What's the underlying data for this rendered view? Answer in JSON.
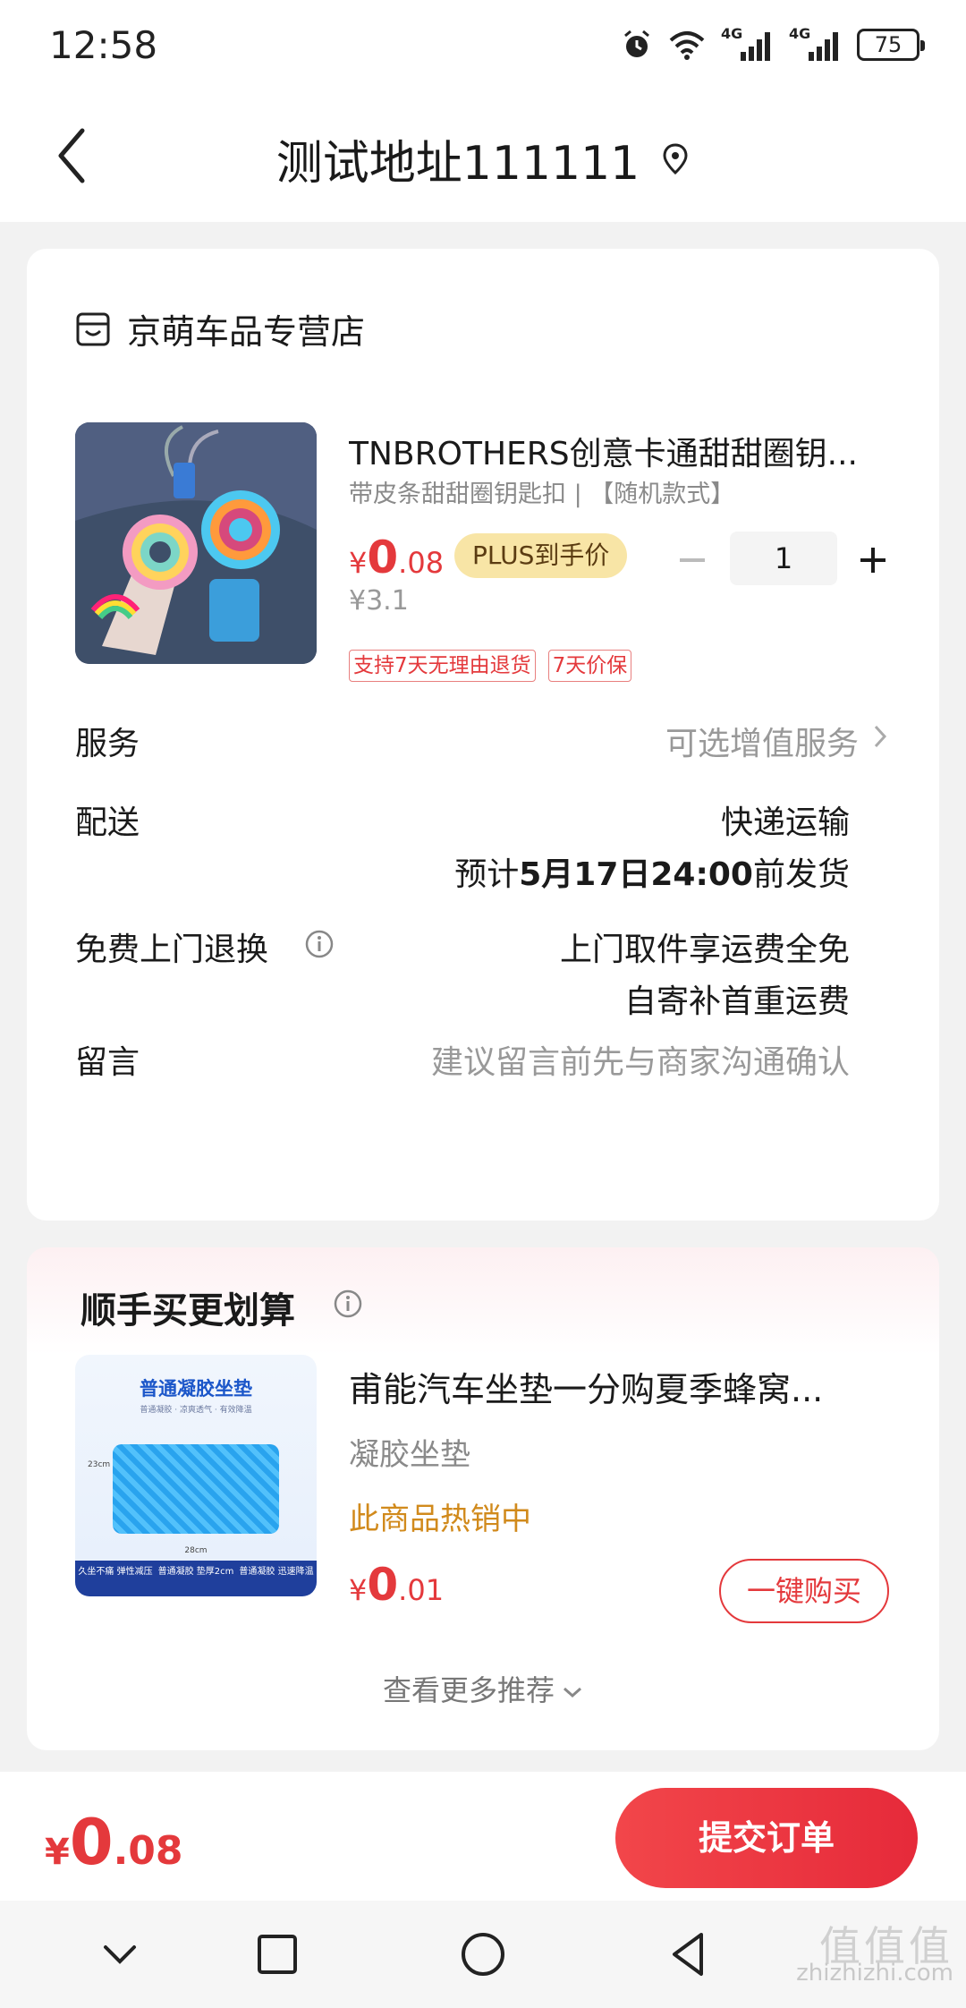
{
  "status_bar": {
    "time": "12:58",
    "signal1_label": "4G",
    "signal2_label": "4G",
    "battery": "75"
  },
  "header": {
    "title": "测试地址111111"
  },
  "store": {
    "name": "京萌车品专营店"
  },
  "product": {
    "title": "TNBROTHERS创意卡通甜甜圈钥...",
    "spec": "带皮条甜甜圈钥匙扣 | 【随机款式】",
    "price_symbol": "¥",
    "price_int": "0",
    "price_dec": ".08",
    "plus_tag": "PLUS到手价",
    "original_price": "¥3.1",
    "quantity": "1",
    "tags": [
      "支持7天无理由退货",
      "7天价保"
    ]
  },
  "rows": {
    "service_label": "服务",
    "service_value": "可选增值服务",
    "delivery_label": "配送",
    "delivery_method": "快递运输",
    "delivery_eta_prefix": "预计",
    "delivery_eta": "5月17日24:00",
    "delivery_eta_suffix": "前发货",
    "return_label": "免费上门退换",
    "return_line1": "上门取件享运费全免",
    "return_line2": "自寄补首重运费",
    "message_label": "留言",
    "message_placeholder": "建议留言前先与商家沟通确认"
  },
  "recommend": {
    "section_title": "顺手买更划算",
    "image_title": "普通凝胶坐垫",
    "image_subtitle": "普通凝胶 · 凉爽透气 · 有效降温",
    "image_dim_h": "23cm",
    "image_dim_w": "28cm",
    "image_footer": [
      "久坐不痛 弹性减压",
      "普通凝胶 垫厚2cm",
      "普通凝胶 迅速降温"
    ],
    "name": "甫能汽车坐垫一分购夏季蜂窝...",
    "spec": "凝胶坐垫",
    "hot": "此商品热销中",
    "price_symbol": "¥",
    "price_int": "0",
    "price_dec": ".01",
    "buy_label": "一键购买",
    "more_label": "查看更多推荐"
  },
  "bottom": {
    "total_symbol": "¥",
    "total_int": "0",
    "total_dec": ".08",
    "submit_label": "提交订单"
  },
  "watermark": {
    "big": "值值值",
    "url": "zhizhizhi.com"
  },
  "colors": {
    "accent": "#e4393c",
    "plus_gold": "#f8e5a6",
    "hot_text": "#d18a1c"
  }
}
